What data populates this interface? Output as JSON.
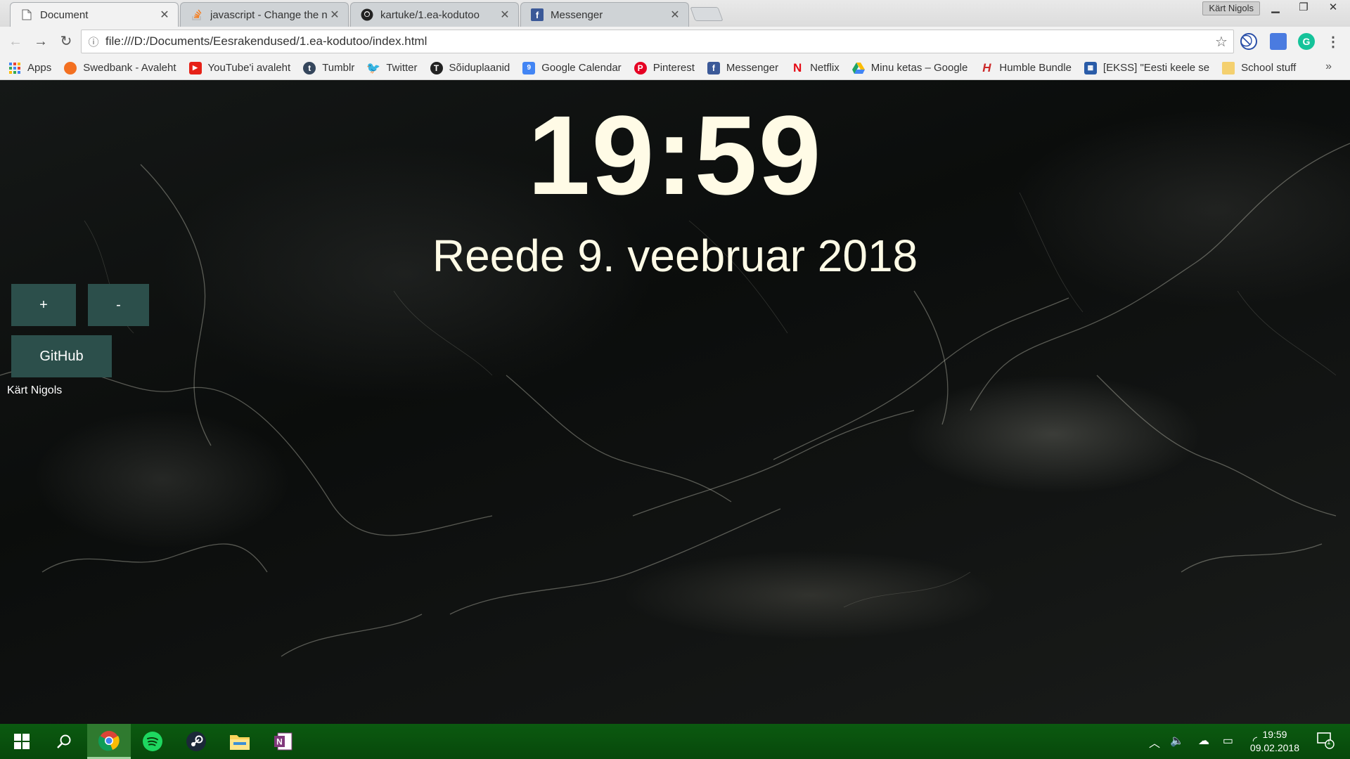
{
  "browser": {
    "tabs": [
      {
        "title": "Document",
        "icon": "document-icon",
        "active": true
      },
      {
        "title": "javascript - Change the n",
        "icon": "stackoverflow-icon",
        "active": false
      },
      {
        "title": "kartuke/1.ea-kodutoo",
        "icon": "github-icon",
        "active": false
      },
      {
        "title": "Messenger",
        "icon": "facebook-icon",
        "active": false
      }
    ],
    "profile_name": "Kärt Nigols",
    "url": "file:///D:/Documents/Eesrakendused/1.ea-kodutoo/index.html",
    "bookmarks": [
      {
        "label": "Apps",
        "icon": "apps-grid-icon",
        "color": "#4285f4"
      },
      {
        "label": "Swedbank - Avaleht",
        "icon": "swedbank-icon",
        "color": "#f37021"
      },
      {
        "label": "YouTube'i avaleht",
        "icon": "youtube-icon",
        "color": "#e62117"
      },
      {
        "label": "Tumblr",
        "icon": "tumblr-icon",
        "color": "#35465c"
      },
      {
        "label": "Twitter",
        "icon": "twitter-icon",
        "color": "#1da1f2"
      },
      {
        "label": "Sõiduplaanid",
        "icon": "transit-icon",
        "color": "#222222"
      },
      {
        "label": "Google Calendar",
        "icon": "calendar-icon",
        "color": "#4285f4"
      },
      {
        "label": "Pinterest",
        "icon": "pinterest-icon",
        "color": "#e60023"
      },
      {
        "label": "Messenger",
        "icon": "facebook-icon",
        "color": "#3b5998"
      },
      {
        "label": "Netflix",
        "icon": "netflix-icon",
        "color": "#e50914"
      },
      {
        "label": "Minu ketas – Google",
        "icon": "google-drive-icon",
        "color": "#1fa463"
      },
      {
        "label": "Humble Bundle",
        "icon": "humble-icon",
        "color": "#cc2929"
      },
      {
        "label": "[EKSS] \"Eesti keele se",
        "icon": "ekss-icon",
        "color": "#2a5ca8"
      },
      {
        "label": "School stuff",
        "icon": "folder-icon",
        "color": "#f4d06f"
      }
    ]
  },
  "page": {
    "time": "19:59",
    "date": "Reede 9. veebruar 2018",
    "plus_label": "+",
    "minus_label": "-",
    "github_label": "GitHub",
    "author": "Kärt Nigols"
  },
  "taskbar": {
    "apps": [
      "windows-start-icon",
      "search-icon",
      "chrome-icon",
      "spotify-icon",
      "steam-icon",
      "file-explorer-icon",
      "onenote-icon"
    ],
    "time": "19:59",
    "date": "09.02.2018",
    "notifications": "1",
    "color": "#0b5a10"
  }
}
